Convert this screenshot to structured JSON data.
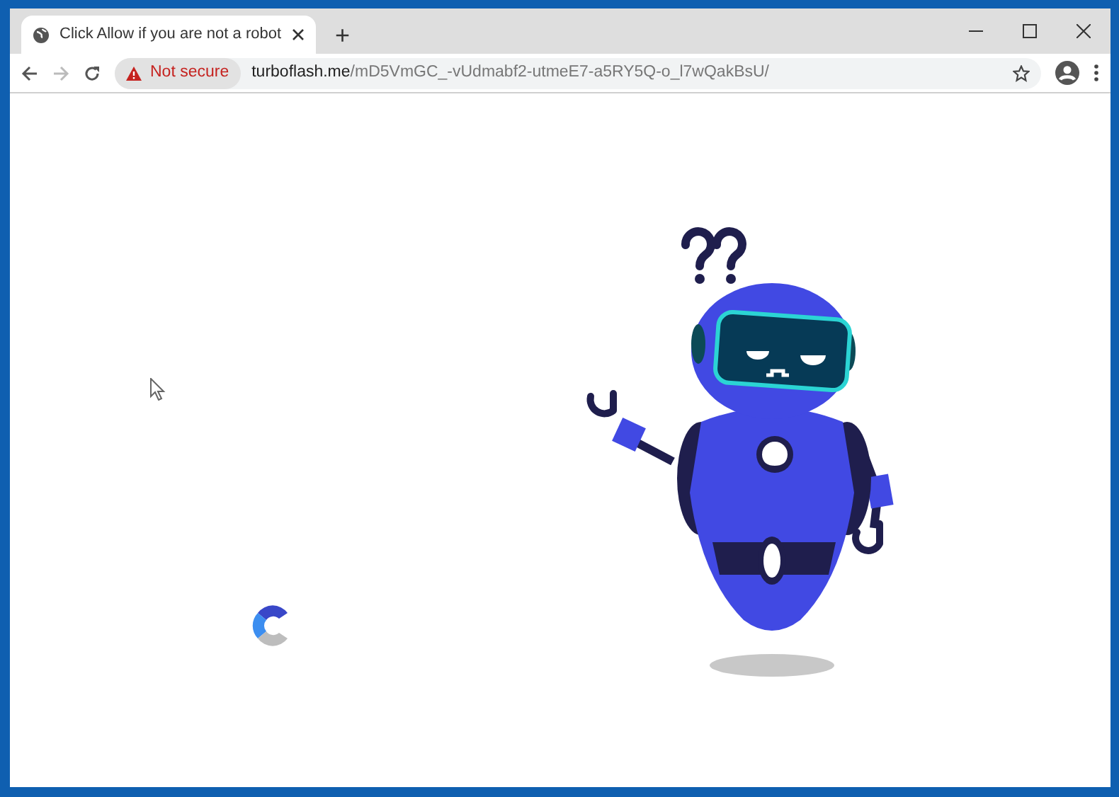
{
  "window": {
    "tab": {
      "title": "Click Allow if you are not a robot",
      "selected": true
    },
    "new_tab": "+"
  },
  "address_bar": {
    "security": "Not secure",
    "url_host": "turboflash.me",
    "url_path": "/mD5VmGC_-vUdmabf2-utmeE7-a5RY5Q-o_l7wQakBsU/"
  }
}
